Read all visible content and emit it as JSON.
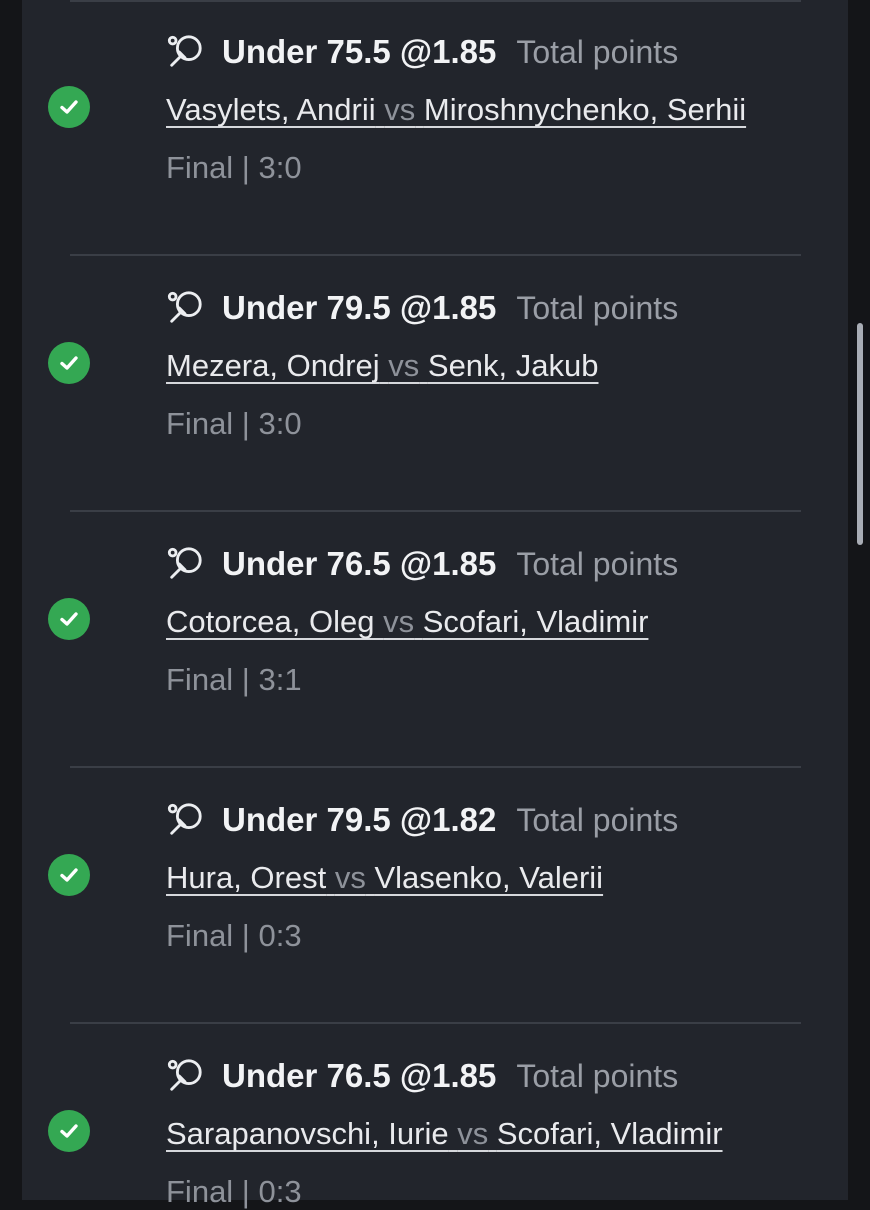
{
  "colors": {
    "panel_bg": "#22252c",
    "outer_bg": "#141518",
    "win_check": "#34a853",
    "text_primary": "#f2f3f5",
    "text_muted": "#9a9ea6"
  },
  "icons": {
    "status": "check-circle-icon",
    "sport": "table-tennis-icon"
  },
  "bets": [
    {
      "pick": "Under 75.5 @1.85",
      "market": "Total points",
      "home": "Vasylets, Andrii",
      "vs": "vs",
      "away": "Miroshnychenko, Serhii",
      "status": "Final | 3:0"
    },
    {
      "pick": "Under 79.5 @1.85",
      "market": "Total points",
      "home": "Mezera, Ondrej",
      "vs": "vs",
      "away": "Senk, Jakub",
      "status": "Final | 3:0"
    },
    {
      "pick": "Under 76.5 @1.85",
      "market": "Total points",
      "home": "Cotorcea, Oleg",
      "vs": "vs",
      "away": "Scofari, Vladimir",
      "status": "Final | 3:1"
    },
    {
      "pick": "Under 79.5 @1.82",
      "market": "Total points",
      "home": "Hura, Orest",
      "vs": "vs",
      "away": "Vlasenko, Valerii",
      "status": "Final | 0:3"
    },
    {
      "pick": "Under 76.5 @1.85",
      "market": "Total points",
      "home": "Sarapanovschi, Iurie",
      "vs": "vs",
      "away": "Scofari, Vladimir",
      "status": "Final | 0:3"
    }
  ]
}
